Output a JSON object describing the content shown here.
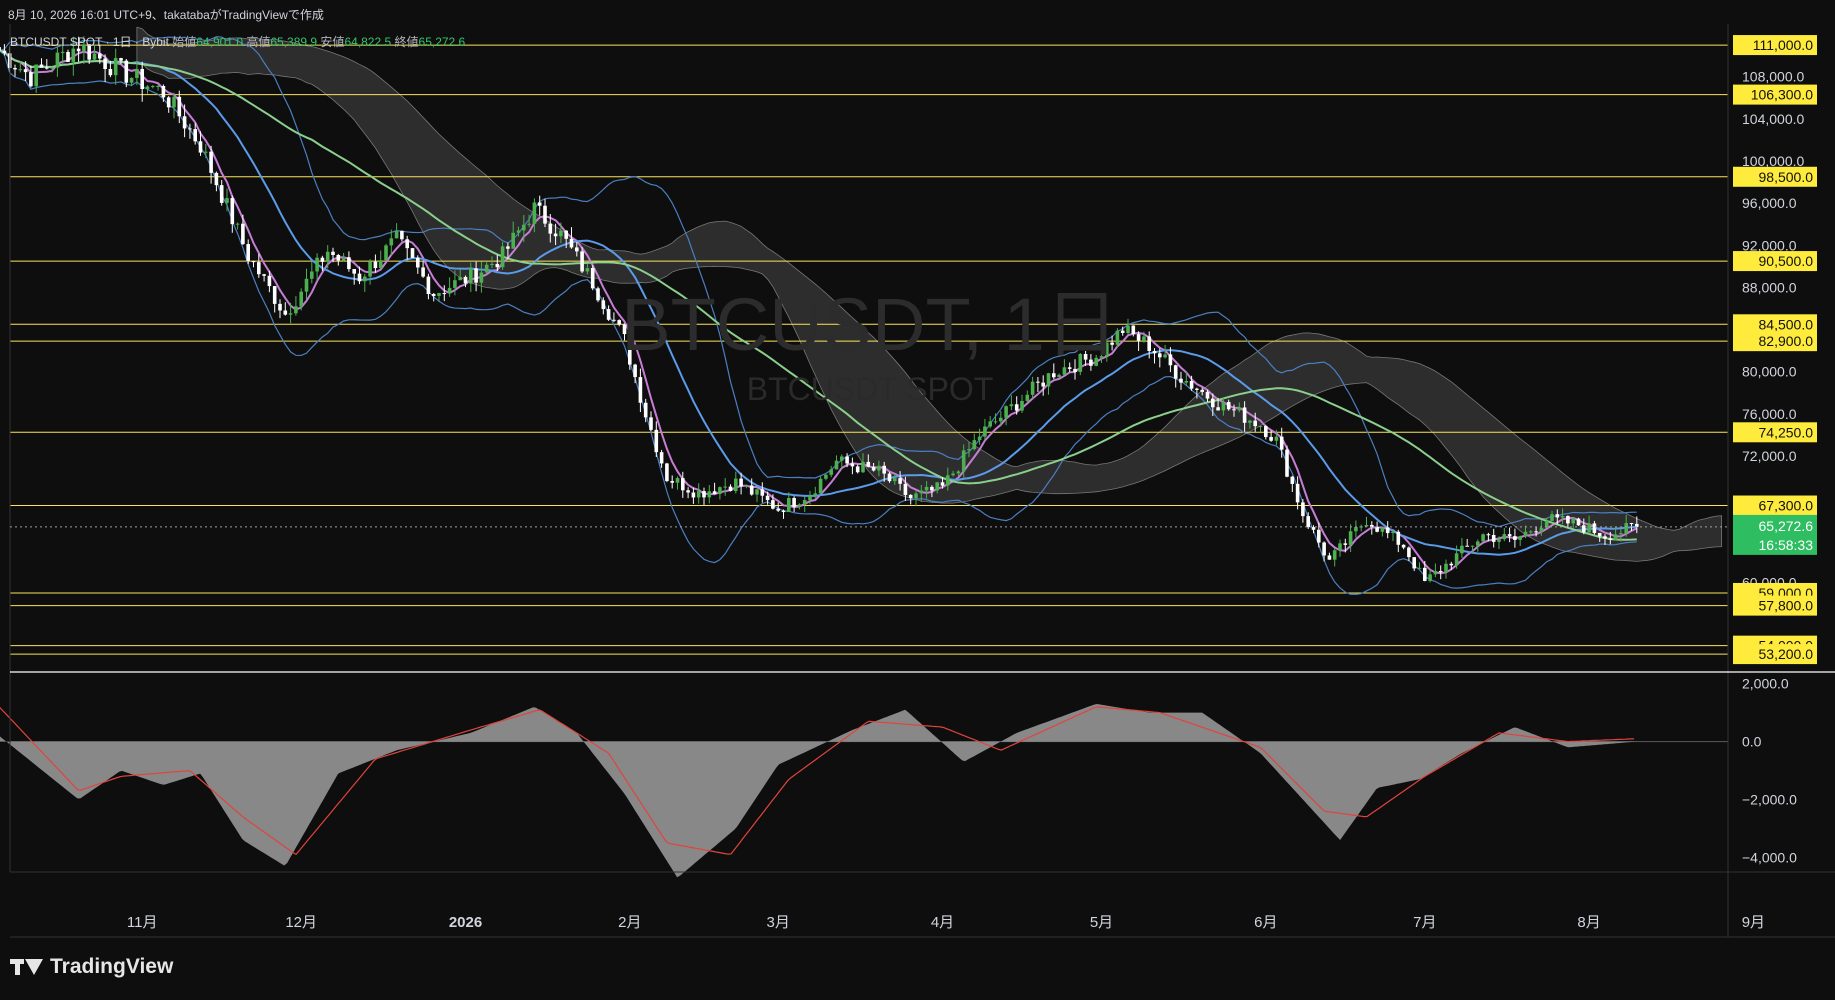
{
  "header": {
    "caption": "8月 10, 2026 16:01 UTC+9、takatabaがTradingViewで作成"
  },
  "legend": {
    "symbol": "BTCUSDT SPOT · 1日 · Bybit",
    "open_label": "始値",
    "open": "64,901.0",
    "high_label": "高値",
    "high": "65,389.9",
    "low_label": "安値",
    "low": "64,822.5",
    "close_label": "終値",
    "close": "65,272.6"
  },
  "watermark": {
    "title": "BTCUSDT, 1日",
    "subtitle": "BTCUSDT SPOT"
  },
  "footer": {
    "brand": "TradingView"
  },
  "colors": {
    "background": "#0e0e0e",
    "up_candle": "#4caf50",
    "down_candle": "#ffffff",
    "level_line": "#fbe45b",
    "level_label_bg": "#ffeb3b",
    "ma_fast": "#c77dd6",
    "ma_mid": "#5b9bea",
    "ma_slow": "#8ccf8c",
    "bollinger": "#4a7fc0",
    "cloud": "#3a3a3a",
    "macd_hist": "#9e9e9e",
    "macd_signal": "#e0443c",
    "current_price_bg": "#2ebd60"
  },
  "chart_data": [
    {
      "type": "candlestick",
      "symbol": "BTCUSDT SPOT",
      "timeframe": "1日",
      "x_tick_labels": [
        "11月",
        "12月",
        "2026",
        "2月",
        "3月",
        "4月",
        "5月",
        "6月",
        "7月",
        "8月",
        "9月"
      ],
      "y_tick_labels": [
        "108,000.0",
        "104,000.0",
        "100,000.0",
        "96,000.0",
        "92,000.0",
        "88,000.0",
        "80,000.0",
        "76,000.0",
        "72,000.0",
        "60,000.0"
      ],
      "ylim": [
        51500,
        113000
      ],
      "horizontal_levels": [
        111000,
        106300,
        98500,
        90500,
        84500,
        82900,
        74250,
        67300,
        59000,
        57800,
        54000,
        53200
      ],
      "horizontal_level_labels": [
        "111,000.0",
        "106,300.0",
        "98,500.0",
        "90,500.0",
        "84,500.0",
        "82,900.0",
        "74,250.0",
        "67,300.0",
        "59,000.0",
        "57,800.0",
        "54,000.0",
        "53,200.0"
      ],
      "current_price": "65,272.6",
      "countdown": "16:58:33",
      "close_path": {
        "x": [
          "2025-10-05",
          "2025-10-11",
          "2025-10-20",
          "2025-10-28",
          "2025-11-05",
          "2025-11-12",
          "2025-11-21",
          "2025-11-28",
          "2025-12-06",
          "2025-12-12",
          "2025-12-19",
          "2025-12-26",
          "2026-01-02",
          "2026-01-08",
          "2026-01-14",
          "2026-01-19",
          "2026-01-25",
          "2026-01-31",
          "2026-02-04",
          "2026-02-08",
          "2026-02-14",
          "2026-02-21",
          "2026-03-01",
          "2026-03-07",
          "2026-03-12",
          "2026-03-20",
          "2026-03-26",
          "2026-04-01",
          "2026-04-08",
          "2026-04-15",
          "2026-04-22",
          "2026-04-30",
          "2026-05-05",
          "2026-05-10",
          "2026-05-16",
          "2026-05-23",
          "2026-05-31",
          "2026-06-03",
          "2026-06-08",
          "2026-06-13",
          "2026-06-20",
          "2026-06-27",
          "2026-07-01",
          "2026-07-07",
          "2026-07-12",
          "2026-07-18",
          "2026-07-24",
          "2026-07-30",
          "2026-08-04",
          "2026-08-10"
        ],
        "close": [
          110500,
          108000,
          111000,
          108500,
          106500,
          101500,
          91000,
          85500,
          91500,
          89000,
          92500,
          87500,
          89000,
          91000,
          95500,
          93000,
          88500,
          83000,
          76000,
          70000,
          68500,
          69500,
          67000,
          68500,
          71500,
          70500,
          68000,
          69000,
          74000,
          77000,
          80000,
          81500,
          84000,
          82500,
          79500,
          77000,
          75000,
          73500,
          66500,
          62000,
          66000,
          63500,
          60000,
          62500,
          64500,
          64000,
          66000,
          65500,
          64500,
          65272.6
        ]
      },
      "overlays": [
        "ma_fast",
        "ma_mid",
        "ma_slow",
        "bollinger_bands",
        "ichimoku_cloud"
      ]
    },
    {
      "type": "area",
      "pane": "oscillator",
      "y_tick_labels": [
        "2,000.0",
        "0.0",
        "−2,000.0",
        "−4,000.0"
      ],
      "ylim": [
        -4500,
        2400
      ],
      "histogram": {
        "x": [
          "2025-10-05",
          "2025-10-20",
          "2025-10-28",
          "2025-11-05",
          "2025-11-12",
          "2025-11-20",
          "2025-11-28",
          "2025-12-08",
          "2025-12-19",
          "2026-01-02",
          "2026-01-14",
          "2026-01-22",
          "2026-01-31",
          "2026-02-10",
          "2026-02-21",
          "2026-03-01",
          "2026-03-15",
          "2026-03-25",
          "2026-04-05",
          "2026-04-15",
          "2026-04-30",
          "2026-05-10",
          "2026-05-20",
          "2026-05-31",
          "2026-06-08",
          "2026-06-15",
          "2026-06-22",
          "2026-06-30",
          "2026-07-08",
          "2026-07-18",
          "2026-07-28",
          "2026-08-10"
        ],
        "values": [
          200,
          -2000,
          -1000,
          -1500,
          -1100,
          -3400,
          -4300,
          -1100,
          -300,
          300,
          1200,
          300,
          -1800,
          -4700,
          -3000,
          -800,
          400,
          1100,
          -700,
          300,
          1300,
          1000,
          1000,
          -400,
          -2000,
          -3400,
          -1600,
          -1300,
          -400,
          500,
          -200,
          0
        ]
      },
      "signal": {
        "x": [
          "2025-10-05",
          "2025-10-20",
          "2025-10-28",
          "2025-11-10",
          "2025-11-20",
          "2025-11-30",
          "2025-12-15",
          "2026-01-02",
          "2026-01-15",
          "2026-01-28",
          "2026-02-08",
          "2026-02-20",
          "2026-03-03",
          "2026-03-18",
          "2026-04-01",
          "2026-04-12",
          "2026-04-30",
          "2026-05-12",
          "2026-05-31",
          "2026-06-12",
          "2026-06-20",
          "2026-07-01",
          "2026-07-15",
          "2026-07-28",
          "2026-08-10"
        ],
        "values": [
          1200,
          -1700,
          -1200,
          -1000,
          -2600,
          -3900,
          -600,
          400,
          1100,
          -400,
          -3500,
          -3900,
          -1300,
          700,
          500,
          -300,
          1200,
          1000,
          -200,
          -2400,
          -2600,
          -1200,
          300,
          0,
          100
        ]
      }
    }
  ]
}
